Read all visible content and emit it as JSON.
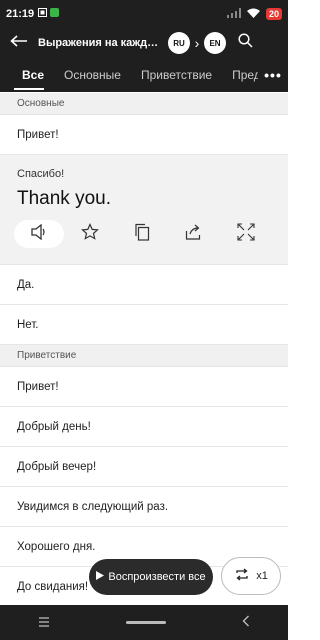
{
  "status": {
    "time": "21:19",
    "battery": "20"
  },
  "header": {
    "title": "Выражения на каждый день",
    "source_lang": "RU",
    "target_lang": "EN"
  },
  "tabs": [
    "Все",
    "Основные",
    "Приветствие",
    "Пред"
  ],
  "sections": {
    "basic": {
      "label": "Основные",
      "items": [
        "Привет!"
      ],
      "expanded": {
        "source": "Спасибо!",
        "translation": "Thank you."
      },
      "items_after": [
        "Да.",
        "Нет."
      ]
    },
    "greeting": {
      "label": "Приветствие",
      "items": [
        "Привет!",
        "Добрый день!",
        "Добрый вечер!",
        "Увидимся в следующий раз.",
        "Хорошего дня.",
        "До свидания!"
      ]
    }
  },
  "player": {
    "play_all": "Воспроизвести все",
    "repeat": "x1"
  },
  "icons": [
    "back-arrow-icon",
    "search-icon",
    "more-icon",
    "speaker-icon",
    "star-icon",
    "copy-icon",
    "share-icon",
    "fullscreen-icon",
    "play-icon",
    "repeat-icon"
  ]
}
